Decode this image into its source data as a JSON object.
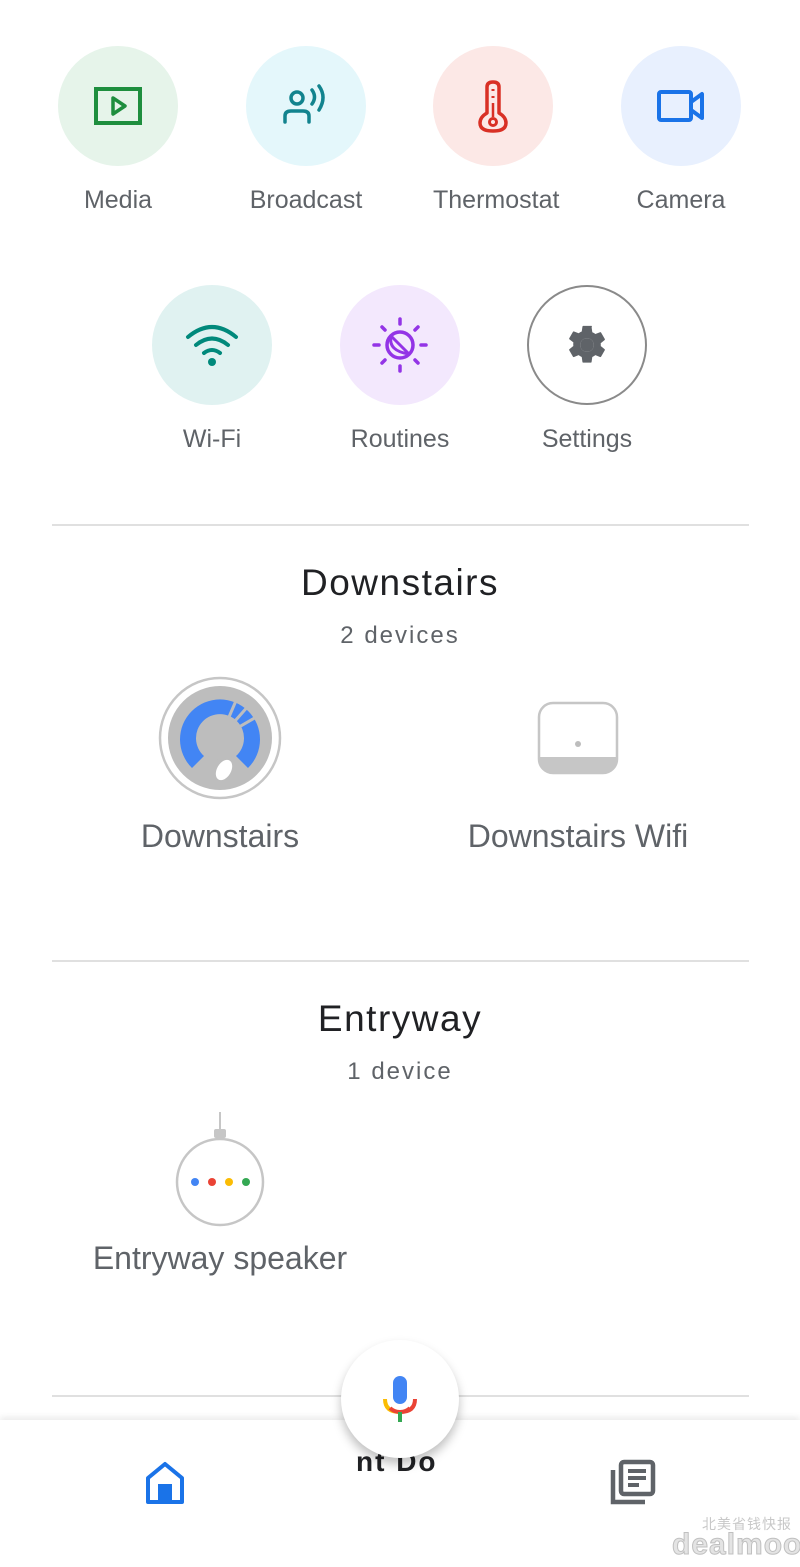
{
  "actions": [
    {
      "label": "Media",
      "icon": "media-icon",
      "bg": "#e6f4ea",
      "color": "#1e8e3e"
    },
    {
      "label": "Broadcast",
      "icon": "broadcast-icon",
      "bg": "#e4f7fb",
      "color": "#12838e"
    },
    {
      "label": "Thermostat",
      "icon": "thermostat-icon",
      "bg": "#fce8e6",
      "color": "#d93025"
    },
    {
      "label": "Camera",
      "icon": "camera-icon",
      "bg": "#e8f0fe",
      "color": "#1a73e8"
    },
    {
      "label": "Wi-Fi",
      "icon": "wifi-icon",
      "bg": "#e0f2f1",
      "color": "#00897b"
    },
    {
      "label": "Routines",
      "icon": "routines-icon",
      "bg": "#f3e8fd",
      "color": "#9334e6"
    },
    {
      "label": "Settings",
      "icon": "settings-icon",
      "bg": "#ffffff",
      "color": "#5f6368"
    }
  ],
  "rooms": [
    {
      "name": "Downstairs",
      "count": "2 devices",
      "devices": [
        {
          "label": "Downstairs",
          "icon": "nest-wifi-router-icon"
        },
        {
          "label": "Downstairs Wifi",
          "icon": "wifi-point-icon"
        }
      ]
    },
    {
      "name": "Entryway",
      "count": "1 device",
      "devices": [
        {
          "label": "Entryway speaker",
          "icon": "google-home-mini-icon"
        }
      ]
    }
  ],
  "partial_room_text": "nt Do",
  "bottom_nav": {
    "home": "home-tab",
    "feed": "feed-tab",
    "active_color": "#1a73e8"
  },
  "watermark": {
    "cn": "北美省钱快报",
    "en": "dealmoon"
  }
}
